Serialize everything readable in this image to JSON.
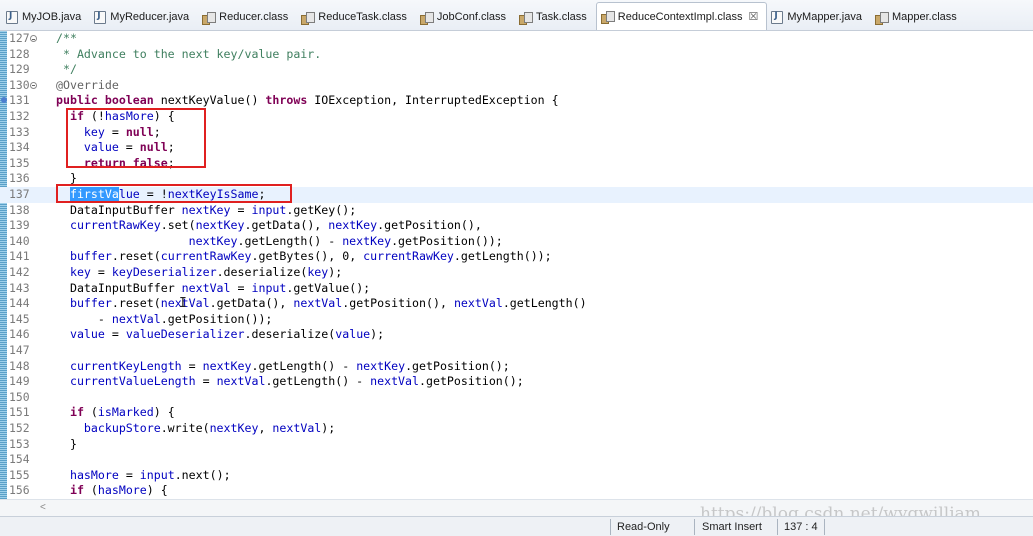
{
  "tabs": [
    {
      "label": "MyJOB.java",
      "icon": "java-file-icon"
    },
    {
      "label": "MyReducer.java",
      "icon": "java-file-icon"
    },
    {
      "label": "Reducer.class",
      "icon": "class-file-icon"
    },
    {
      "label": "ReduceTask.class",
      "icon": "class-file-icon"
    },
    {
      "label": "JobConf.class",
      "icon": "class-file-icon"
    },
    {
      "label": "Task.class",
      "icon": "class-file-icon"
    },
    {
      "label": "ReduceContextImpl.class",
      "icon": "class-file-icon",
      "active": true,
      "close": "☒"
    },
    {
      "label": "MyMapper.java",
      "icon": "java-file-icon"
    },
    {
      "label": "Mapper.class",
      "icon": "class-file-icon"
    }
  ],
  "line_numbers": [
    "127",
    "128",
    "129",
    "130",
    "131",
    "132",
    "133",
    "134",
    "135",
    "136",
    "137",
    "138",
    "139",
    "140",
    "141",
    "142",
    "143",
    "144",
    "145",
    "146",
    "147",
    "148",
    "149",
    "150",
    "151",
    "152",
    "153",
    "154",
    "155",
    "156"
  ],
  "code": {
    "l127": "/**",
    "l128": " * Advance to the next key/value pair.",
    "l129": " */",
    "l130": "@Override",
    "l131_kw1": "public boolean",
    "l131_rest": " nextKeyValue() ",
    "l131_kw2": "throws",
    "l131_tail": " IOException, InterruptedException {",
    "l132_kw": "if",
    "l132_a": " (!",
    "l132_fd": "hasMore",
    "l132_b": ") {",
    "l133_fd": "key",
    "l133_a": " = ",
    "l133_kw": "null",
    "l133_b": ";",
    "l134_fd": "value",
    "l134_a": " = ",
    "l134_kw": "null",
    "l134_b": ";",
    "l135_kw": "return false",
    "l135_b": ";",
    "l136": "}",
    "l137_sel": "firstVa",
    "l137_fd": "lue",
    "l137_a": " = !",
    "l137_fd2": "nextKeyIsSame",
    "l137_b": ";",
    "l138_a": "DataInputBuffer ",
    "l138_fd": "nextKey",
    "l138_b": " = ",
    "l138_fd2": "input",
    "l138_c": ".getKey();",
    "l139_fd": "currentRawKey",
    "l139_a": ".set(",
    "l139_fd2": "nextKey",
    "l139_b": ".getData(), ",
    "l139_fd3": "nextKey",
    "l139_c": ".getPosition(),",
    "l140_fd": "nextKey",
    "l140_a": ".getLength() - ",
    "l140_fd2": "nextKey",
    "l140_b": ".getPosition());",
    "l141_fd": "buffer",
    "l141_a": ".reset(",
    "l141_fd2": "currentRawKey",
    "l141_b": ".getBytes(), 0, ",
    "l141_fd3": "currentRawKey",
    "l141_c": ".getLength());",
    "l142_fd": "key",
    "l142_a": " = ",
    "l142_fd2": "keyDeserializer",
    "l142_b": ".deserialize(",
    "l142_fd3": "key",
    "l142_c": ");",
    "l143_a": "DataInputBuffer ",
    "l143_fd": "nextVal",
    "l143_b": " = ",
    "l143_fd2": "input",
    "l143_c": ".getValue();",
    "l144_fd": "buffer",
    "l144_a": ".reset(",
    "l144_fd2": "nextVal",
    "l144_b": ".getData(), ",
    "l144_fd3": "nextVal",
    "l144_c": ".getPosition(), ",
    "l144_fd4": "nextVal",
    "l144_d": ".getLength()",
    "l145_a": "- ",
    "l145_fd": "nextVal",
    "l145_b": ".getPosition());",
    "l146_fd": "value",
    "l146_a": " = ",
    "l146_fd2": "valueDeserializer",
    "l146_b": ".deserialize(",
    "l146_fd3": "value",
    "l146_c": ");",
    "l148_fd": "currentKeyLength",
    "l148_a": " = ",
    "l148_fd2": "nextKey",
    "l148_b": ".getLength() - ",
    "l148_fd3": "nextKey",
    "l148_c": ".getPosition();",
    "l149_fd": "currentValueLength",
    "l149_a": " = ",
    "l149_fd2": "nextVal",
    "l149_b": ".getLength() - ",
    "l149_fd3": "nextVal",
    "l149_c": ".getPosition();",
    "l151_kw": "if",
    "l151_a": " (",
    "l151_fd": "isMarked",
    "l151_b": ") {",
    "l152_fd": "backupStore",
    "l152_a": ".write(",
    "l152_fd2": "nextKey",
    "l152_b": ", ",
    "l152_fd3": "nextVal",
    "l152_c": ");",
    "l153": "}",
    "l155_fd": "hasMore",
    "l155_a": " = ",
    "l155_fd2": "input",
    "l155_b": ".next();",
    "l156_kw": "if",
    "l156_a": " (",
    "l156_fd": "hasMore",
    "l156_b": ") {"
  },
  "status": {
    "mode": "Read-Only",
    "insert": "Smart Insert",
    "position": "137 : 4"
  },
  "watermark": "https://blog.csdn.net/wyqwilliam",
  "colors": {
    "keyword": "#7f0055",
    "comment": "#3f7f5f",
    "field": "#0000c0",
    "selection": "#3399ff",
    "current_line": "#e8f2fe",
    "annotation_box": "#e02020"
  }
}
